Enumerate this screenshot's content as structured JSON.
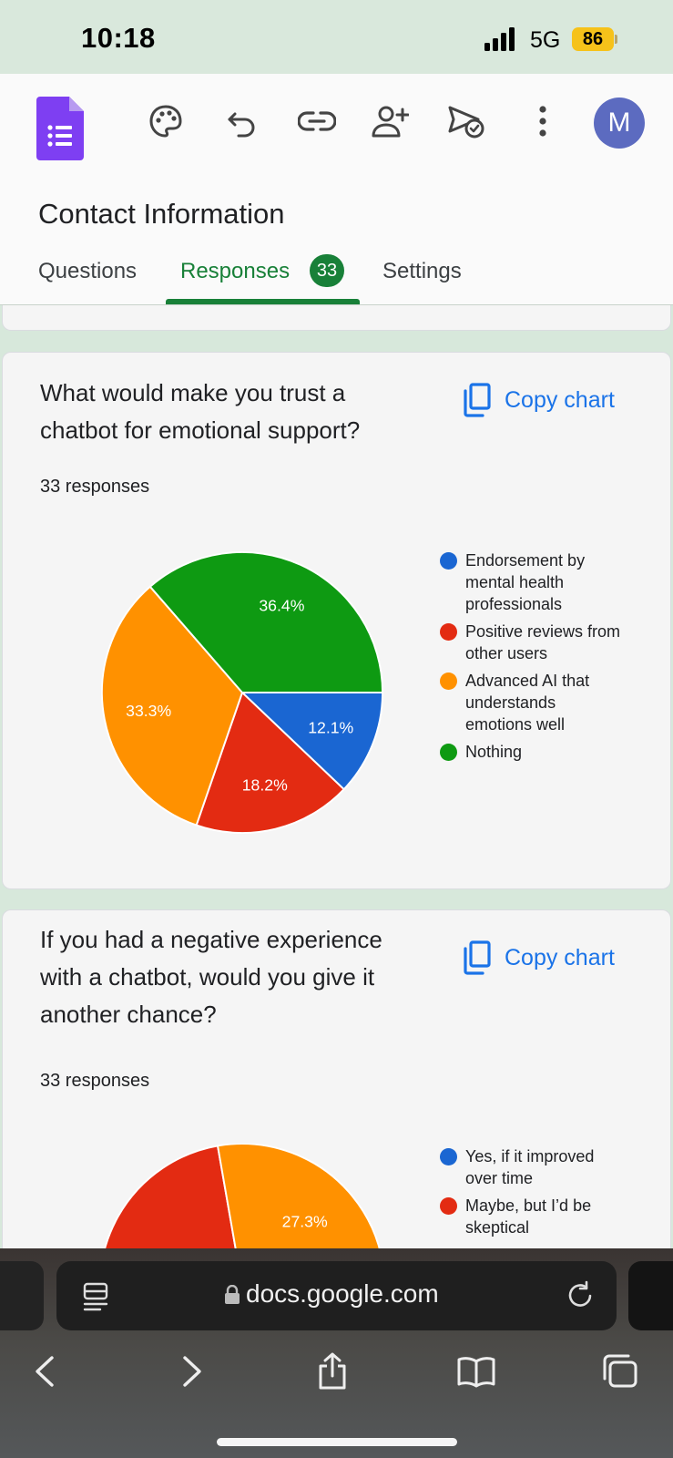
{
  "status": {
    "time": "10:18",
    "network": "5G",
    "battery": "86"
  },
  "toolbar": {
    "icons": [
      "forms-logo-icon",
      "palette-icon",
      "undo-icon",
      "link-icon",
      "add-collaborator-icon",
      "send-icon",
      "more-vert-icon"
    ],
    "avatar_letter": "M"
  },
  "form": {
    "title": "Contact Information"
  },
  "tabs": [
    {
      "label": "Questions"
    },
    {
      "label": "Responses",
      "badge": "33",
      "active": true
    },
    {
      "label": "Settings"
    }
  ],
  "questions": [
    {
      "title": "What would make you trust a chatbot for emotional support?",
      "responses": "33 responses",
      "copy_label": "Copy chart",
      "legend": [
        "Endorsement by mental health professionals",
        "Positive reviews from other users",
        "Advanced AI that understands emotions well",
        "Nothing"
      ]
    },
    {
      "title": "If you had a negative experience with a chatbot, would you give it another chance?",
      "responses": "33 responses",
      "copy_label": "Copy chart",
      "legend": [
        "Yes, if it improved over time",
        "Maybe, but I’d be skeptical"
      ]
    }
  ],
  "chart_data": [
    {
      "type": "pie",
      "labels": [
        "Endorsement by mental health professionals",
        "Positive reviews from other users",
        "Advanced AI that understands emotions well",
        "Nothing"
      ],
      "values": [
        12.1,
        18.2,
        33.3,
        36.4
      ],
      "value_labels": [
        "12.1%",
        "18.2%",
        "33.3%",
        "36.4%"
      ],
      "colors": [
        "#1a66d2",
        "#e32b12",
        "#ff9100",
        "#0e9a12"
      ],
      "legend": "right"
    },
    {
      "type": "pie",
      "labels": [
        "Yes, if it improved over time",
        "Maybe, but I’d be skeptical"
      ],
      "visible_value_labels": [
        "27.3%"
      ],
      "colors": [
        "#1a66d2",
        "#e32b12",
        "#ff9100"
      ],
      "legend": "right"
    }
  ],
  "browser": {
    "url": "docs.google.com"
  }
}
